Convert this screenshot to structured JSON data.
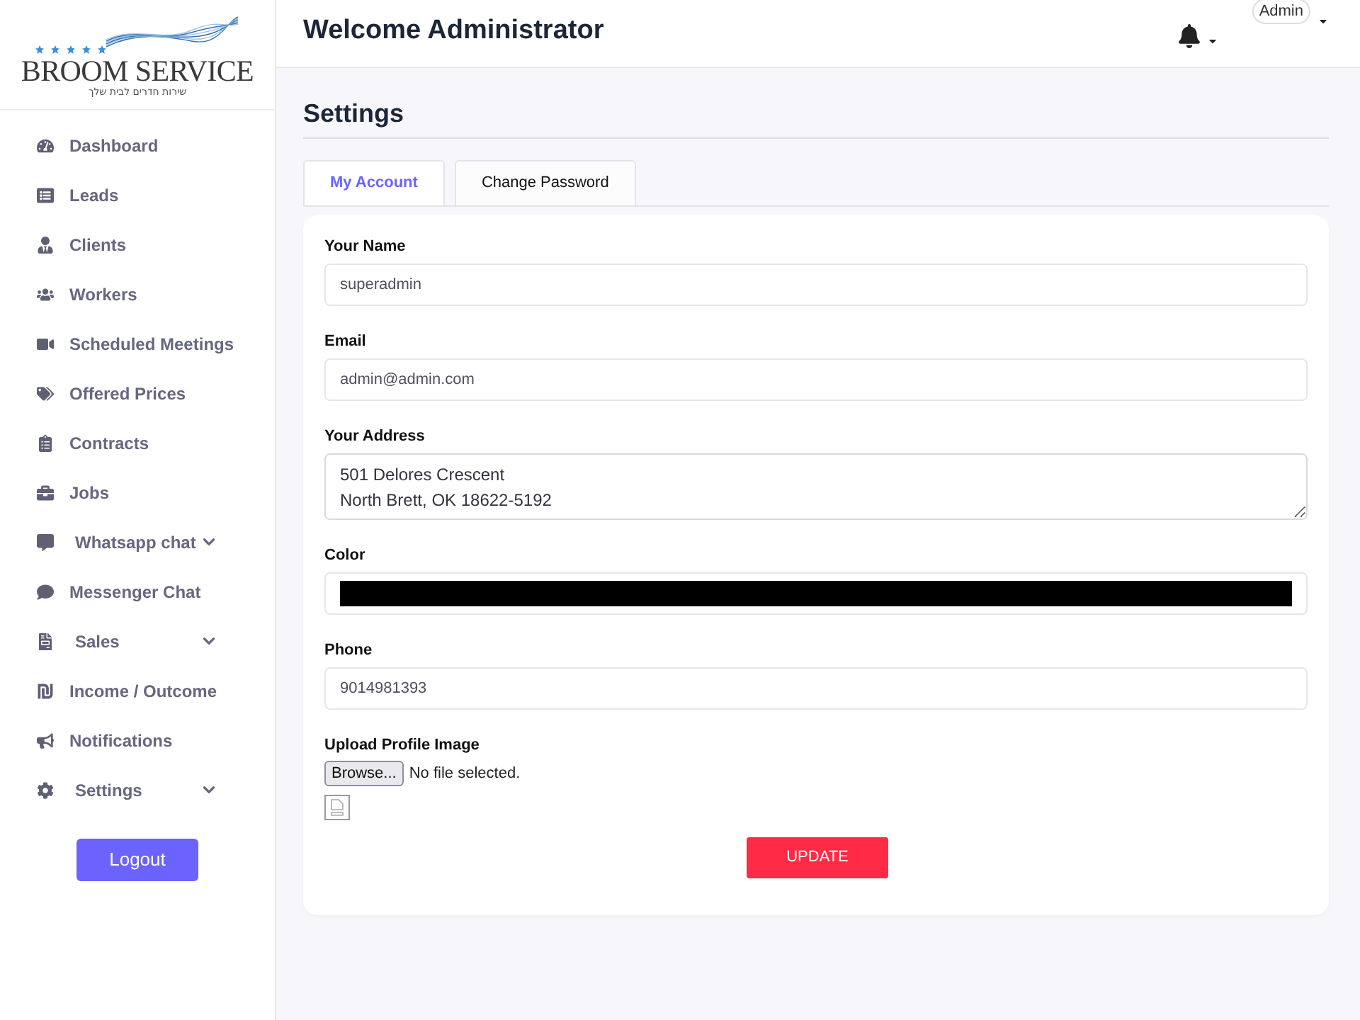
{
  "logo": {
    "name": "BROOM SERVICE",
    "tagline": "שירות חדרים לבית שלך"
  },
  "sidebar": {
    "items": [
      {
        "label": "Dashboard",
        "kind": "link"
      },
      {
        "label": "Leads",
        "kind": "link"
      },
      {
        "label": "Clients",
        "kind": "link"
      },
      {
        "label": "Workers",
        "kind": "link"
      },
      {
        "label": "Scheduled Meetings",
        "kind": "link"
      },
      {
        "label": "Offered Prices",
        "kind": "link"
      },
      {
        "label": "Contracts",
        "kind": "link"
      },
      {
        "label": "Jobs",
        "kind": "link"
      },
      {
        "label": "Whatsapp chat",
        "kind": "dropdown"
      },
      {
        "label": "Messenger Chat",
        "kind": "link"
      },
      {
        "label": "Sales",
        "kind": "dropdown"
      },
      {
        "label": "Income / Outcome",
        "kind": "link"
      },
      {
        "label": "Notifications",
        "kind": "link"
      },
      {
        "label": "Settings",
        "kind": "dropdown"
      }
    ],
    "logout": "Logout"
  },
  "header": {
    "title": "Welcome Administrator",
    "user": "Admin"
  },
  "page": {
    "title": "Settings"
  },
  "tabs": [
    {
      "label": "My Account",
      "selected": true
    },
    {
      "label": "Change Password",
      "selected": false
    }
  ],
  "form": {
    "fields": [
      {
        "label": "Your Name",
        "kind": "text",
        "value": "superadmin"
      },
      {
        "label": "Email",
        "kind": "text",
        "value": "admin@admin.com"
      },
      {
        "label": "Your Address",
        "kind": "textarea",
        "value": "501 Delores Crescent\nNorth Brett, OK 18622-5192"
      },
      {
        "label": "Color",
        "kind": "color",
        "color": "#000000"
      },
      {
        "label": "Phone",
        "kind": "text",
        "value": "9014981393"
      }
    ],
    "upload": {
      "label": "Upload Profile Image",
      "button": "Browse...",
      "status": "No file selected."
    },
    "submit": "UPDATE"
  }
}
